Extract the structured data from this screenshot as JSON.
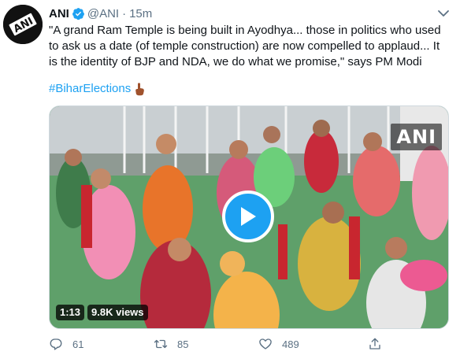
{
  "tweet": {
    "display_name": "ANI",
    "handle": "@ANI",
    "separator": "·",
    "time": "15m",
    "avatar_logo_text": "ANI",
    "text": "\"A grand Ram Temple is being built in Ayodhya... those in politics who used to ask us a date (of temple construction) are now compelled to applaud... It is the identity of BJP and NDA, we do what we promise,\" says PM Modi",
    "hashtag": "#BiharElections"
  },
  "media": {
    "watermark": "ANI",
    "duration": "1:13",
    "views": "9.8K views"
  },
  "actions": {
    "replies": "61",
    "retweets": "85",
    "likes": "489"
  },
  "colors": {
    "accent": "#1da1f2",
    "text": "#0f1419",
    "muted": "#5b7083"
  },
  "icons": [
    "verified-badge-icon",
    "caret-down-icon",
    "finger-pointing-icon",
    "play-icon",
    "reply-icon",
    "retweet-icon",
    "like-icon",
    "share-icon"
  ]
}
